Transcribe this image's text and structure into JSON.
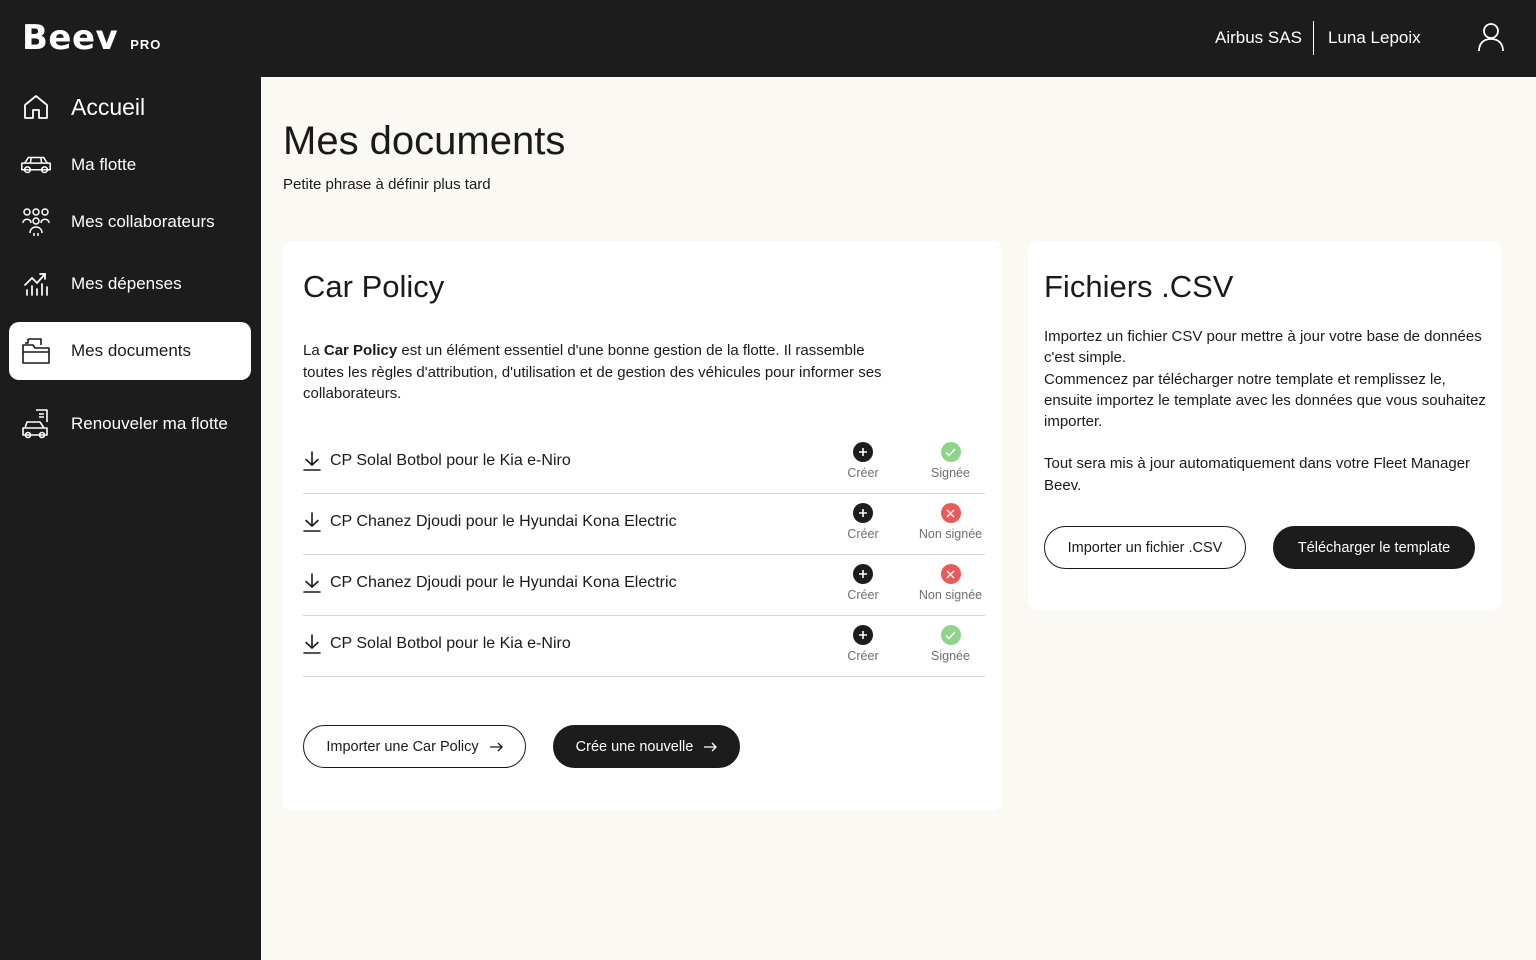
{
  "header": {
    "logo_text": "Beev",
    "logo_suffix": "PRO",
    "company": "Airbus SAS",
    "user": "Luna Lepoix",
    "user_icon": "user-icon"
  },
  "sidebar": {
    "items": [
      {
        "label": "Accueil",
        "icon": "home-icon",
        "active": false
      },
      {
        "label": "Ma flotte",
        "icon": "car-icon",
        "active": false
      },
      {
        "label": "Mes collaborateurs",
        "icon": "people-icon",
        "active": false
      },
      {
        "label": "Mes dépenses",
        "icon": "chart-icon",
        "active": false
      },
      {
        "label": "Mes documents",
        "icon": "folder-icon",
        "active": true
      },
      {
        "label": "Renouveler ma flotte",
        "icon": "car-renew-icon",
        "active": false
      }
    ]
  },
  "page": {
    "title": "Mes documents",
    "subtitle": "Petite phrase à définir plus tard"
  },
  "car_policy": {
    "title": "Car Policy",
    "desc_prefix": "La ",
    "desc_bold": "Car Policy",
    "desc_rest": " est un élément essentiel d'une bonne gestion de la flotte. Il rassemble toutes les règles d'attribution, d'utilisation et de gestion des véhicules pour informer ses collaborateurs.",
    "documents": [
      {
        "name": "CP Solal Botbol pour le Kia e-Niro",
        "create_label": "Créer",
        "status": "Signée",
        "signed": true
      },
      {
        "name": "CP Chanez Djoudi pour le Hyundai Kona Electric",
        "create_label": "Créer",
        "status": "Non signée",
        "signed": false
      },
      {
        "name": "CP Chanez Djoudi pour le Hyundai Kona Electric",
        "create_label": "Créer",
        "status": "Non signée",
        "signed": false
      },
      {
        "name": "CP Solal Botbol pour le Kia e-Niro",
        "create_label": "Créer",
        "status": "Signée",
        "signed": true
      }
    ],
    "import_button": "Importer une Car Policy",
    "create_button": "Crée une nouvelle"
  },
  "csv": {
    "title": "Fichiers .CSV",
    "para1_line1": "Importez un fichier CSV pour mettre à jour votre base de données c'est simple.",
    "para1_line2": "Commencez par télécharger notre template et remplissez le, ensuite importez le template avec les données que vous souhaitez importer.",
    "para2": "Tout sera mis à jour automatiquement dans votre Fleet Manager Beev.",
    "import_button": "Importer un fichier .CSV",
    "download_button": "Télécharger le template"
  },
  "colors": {
    "dark": "#1c1c1c",
    "background": "#fbf9f4",
    "signed": "#8fd48a",
    "unsigned": "#e95a5a"
  }
}
